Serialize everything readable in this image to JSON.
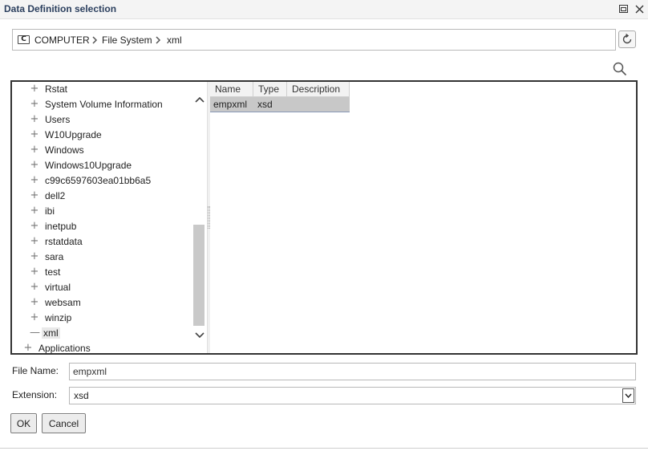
{
  "window": {
    "title": "Data Definition selection",
    "icons": [
      "restore-icon",
      "close-icon"
    ]
  },
  "breadcrumb": {
    "drive_icon_letter": "C",
    "items": [
      "COMPUTER",
      "File System",
      "xml"
    ]
  },
  "tree": {
    "items": [
      {
        "label": "Rstat",
        "expander": "+"
      },
      {
        "label": "System Volume Information",
        "expander": "+"
      },
      {
        "label": "Users",
        "expander": "+"
      },
      {
        "label": "W10Upgrade",
        "expander": "+"
      },
      {
        "label": "Windows",
        "expander": "+"
      },
      {
        "label": "Windows10Upgrade",
        "expander": "+"
      },
      {
        "label": "c99c6597603ea01bb6a5",
        "expander": "+"
      },
      {
        "label": "dell2",
        "expander": "+"
      },
      {
        "label": "ibi",
        "expander": "+"
      },
      {
        "label": "inetpub",
        "expander": "+"
      },
      {
        "label": "rstatdata",
        "expander": "+"
      },
      {
        "label": "sara",
        "expander": "+"
      },
      {
        "label": "test",
        "expander": "+"
      },
      {
        "label": "virtual",
        "expander": "+"
      },
      {
        "label": "websam",
        "expander": "+"
      },
      {
        "label": "winzip",
        "expander": "+"
      },
      {
        "label": "xml",
        "expander": "—",
        "selected": true
      },
      {
        "label": "Applications",
        "expander": "+"
      }
    ]
  },
  "filelist": {
    "columns": [
      "Name",
      "Type",
      "Description"
    ],
    "rows": [
      {
        "name": "empxml",
        "type": "xsd",
        "description": ""
      }
    ]
  },
  "form": {
    "file_name_label": "File Name:",
    "file_name_value": "empxml",
    "extension_label": "Extension:",
    "extension_value": "xsd"
  },
  "buttons": {
    "ok": "OK",
    "cancel": "Cancel"
  }
}
